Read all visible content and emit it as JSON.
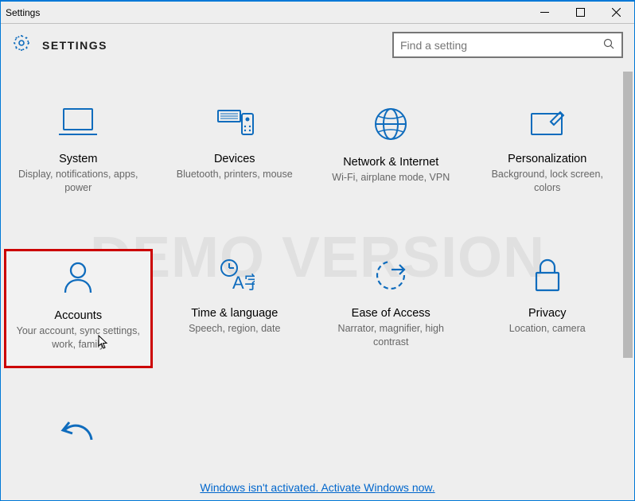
{
  "window": {
    "title": "Settings"
  },
  "header": {
    "page_title": "SETTINGS"
  },
  "search": {
    "placeholder": "Find a setting"
  },
  "watermark": "DEMO VERSION",
  "tiles": [
    {
      "name": "System",
      "desc": "Display, notifications, apps, power",
      "icon": "laptop"
    },
    {
      "name": "Devices",
      "desc": "Bluetooth, printers, mouse",
      "icon": "devices"
    },
    {
      "name": "Network & Internet",
      "desc": "Wi-Fi, airplane mode, VPN",
      "icon": "globe"
    },
    {
      "name": "Personalization",
      "desc": "Background, lock screen, colors",
      "icon": "personalize"
    },
    {
      "name": "Accounts",
      "desc": "Your account, sync settings, work, family",
      "icon": "person",
      "highlight": true
    },
    {
      "name": "Time & language",
      "desc": "Speech, region, date",
      "icon": "time-lang"
    },
    {
      "name": "Ease of Access",
      "desc": "Narrator, magnifier, high contrast",
      "icon": "ease"
    },
    {
      "name": "Privacy",
      "desc": "Location, camera",
      "icon": "lock"
    },
    {
      "name": "",
      "desc": "",
      "icon": "undo"
    }
  ],
  "footer_link": "Windows isn't activated. Activate Windows now.",
  "colors": {
    "accent": "#0078d7",
    "icon": "#0F6CBD",
    "link": "#0066cc"
  }
}
